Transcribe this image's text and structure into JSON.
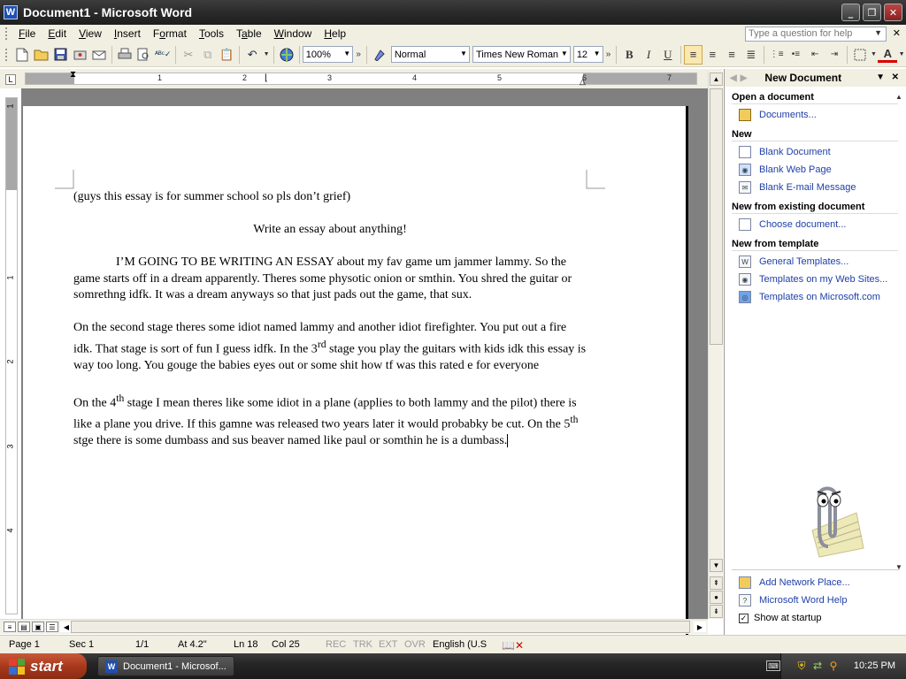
{
  "window": {
    "title": "Document1 - Microsoft Word",
    "app_icon": "W",
    "controls": [
      "_",
      "❐",
      "✕"
    ]
  },
  "menu": {
    "items": [
      {
        "label": "File",
        "u": "F",
        "rest": "ile"
      },
      {
        "label": "Edit",
        "u": "E",
        "rest": "dit"
      },
      {
        "label": "View",
        "u": "V",
        "rest": "iew"
      },
      {
        "label": "Insert",
        "u": "I",
        "rest": "nsert"
      },
      {
        "label": "Format",
        "u": "o",
        "pre": "F",
        "rest": "rmat"
      },
      {
        "label": "Tools",
        "u": "T",
        "rest": "ools"
      },
      {
        "label": "Table",
        "u": "a",
        "pre": "T",
        "rest": "ble"
      },
      {
        "label": "Window",
        "u": "W",
        "rest": "indow"
      },
      {
        "label": "Help",
        "u": "H",
        "rest": "elp"
      }
    ],
    "help_placeholder": "Type a question for help"
  },
  "toolbar": {
    "zoom": "100%",
    "style": "Normal",
    "font": "Times New Roman",
    "size": "12",
    "bold": "B",
    "italic": "I",
    "underline": "U"
  },
  "ruler": {
    "numbers": [
      "1",
      "2",
      "3",
      "4",
      "5",
      "6",
      "7"
    ],
    "vnumbers": [
      "1",
      "1",
      "2",
      "3",
      "4"
    ]
  },
  "document": {
    "line1": "(guys this essay is for summer school so pls don’t grief)",
    "line2": "Write an essay about anything!",
    "p1": "I’M GOING TO BE WRITING AN ESSAY about my fav game um jammer lammy. So the game starts off in a dream apparently. Theres some physotic onion or smthin. You shred the guitar or somrethng idfk. It was a dream anyways so that just pads out the game, that sux.",
    "p2a": "On the second stage theres some idiot named lammy and another idiot firefighter.  You put out a fire idk. That stage is sort of fun I guess idfk. In the 3",
    "p2sup": "rd",
    "p2b": " stage you play the guitars with kids idk this essay is way too long.  You gouge the babies eyes out or some shit how tf was this rated e for everyone",
    "p3a": "On the 4",
    "p3sup1": "th",
    "p3b": " stage I mean theres like some idiot in a plane (applies to both lammy and the pilot) there is like a plane you drive. If this gamne was released two years later it would probabky be cut. On the 5",
    "p3sup2": "th",
    "p3c": " stge there is some dumbass and sus beaver named like paul or somthin he is a dumbass."
  },
  "status": {
    "page": "Page 1",
    "sec": "Sec 1",
    "pages": "1/1",
    "at": "At 4.2\"",
    "ln": "Ln 18",
    "col": "Col 25",
    "rec": "REC",
    "trk": "TRK",
    "ext": "EXT",
    "ovr": "OVR",
    "lang": "English (U.S"
  },
  "taskpane": {
    "title": "New Document",
    "open_heading": "Open a document",
    "open_items": [
      "Documents..."
    ],
    "new_heading": "New",
    "new_items": [
      "Blank Document",
      "Blank Web Page",
      "Blank E-mail Message"
    ],
    "existing_heading": "New from existing document",
    "existing_items": [
      "Choose document..."
    ],
    "template_heading": "New from template",
    "template_items": [
      "General Templates...",
      "Templates on my Web Sites...",
      "Templates on Microsoft.com"
    ],
    "bottom_items": [
      "Add Network Place...",
      "Microsoft Word Help"
    ],
    "show_startup": "Show at startup"
  },
  "taskbar": {
    "start": "start",
    "task": "Document1 - Microsof...",
    "clock": "10:25 PM"
  }
}
